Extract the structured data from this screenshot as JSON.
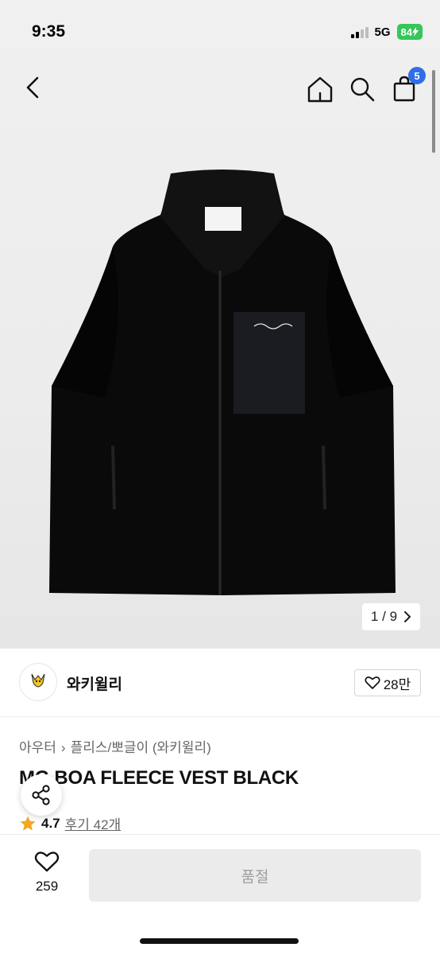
{
  "status": {
    "time": "9:35",
    "network": "5G",
    "battery": "84"
  },
  "header": {
    "cart_count": "5"
  },
  "gallery": {
    "page_current": "1",
    "page_total": "9",
    "page_sep": "/"
  },
  "store": {
    "name": "와키윌리",
    "likes": "28만"
  },
  "product": {
    "breadcrumb": [
      "아우터",
      "플리스/뽀글이 (와키윌리)"
    ],
    "title": "MG BOA FLEECE VEST BLACK",
    "rating": "4.7",
    "reviews": "후기 42개"
  },
  "bottom": {
    "wish_count": "259",
    "buy_label": "품절"
  },
  "colors": {
    "accent": "#2f6ee7",
    "star": "#f5a623",
    "battery": "#34c759"
  }
}
